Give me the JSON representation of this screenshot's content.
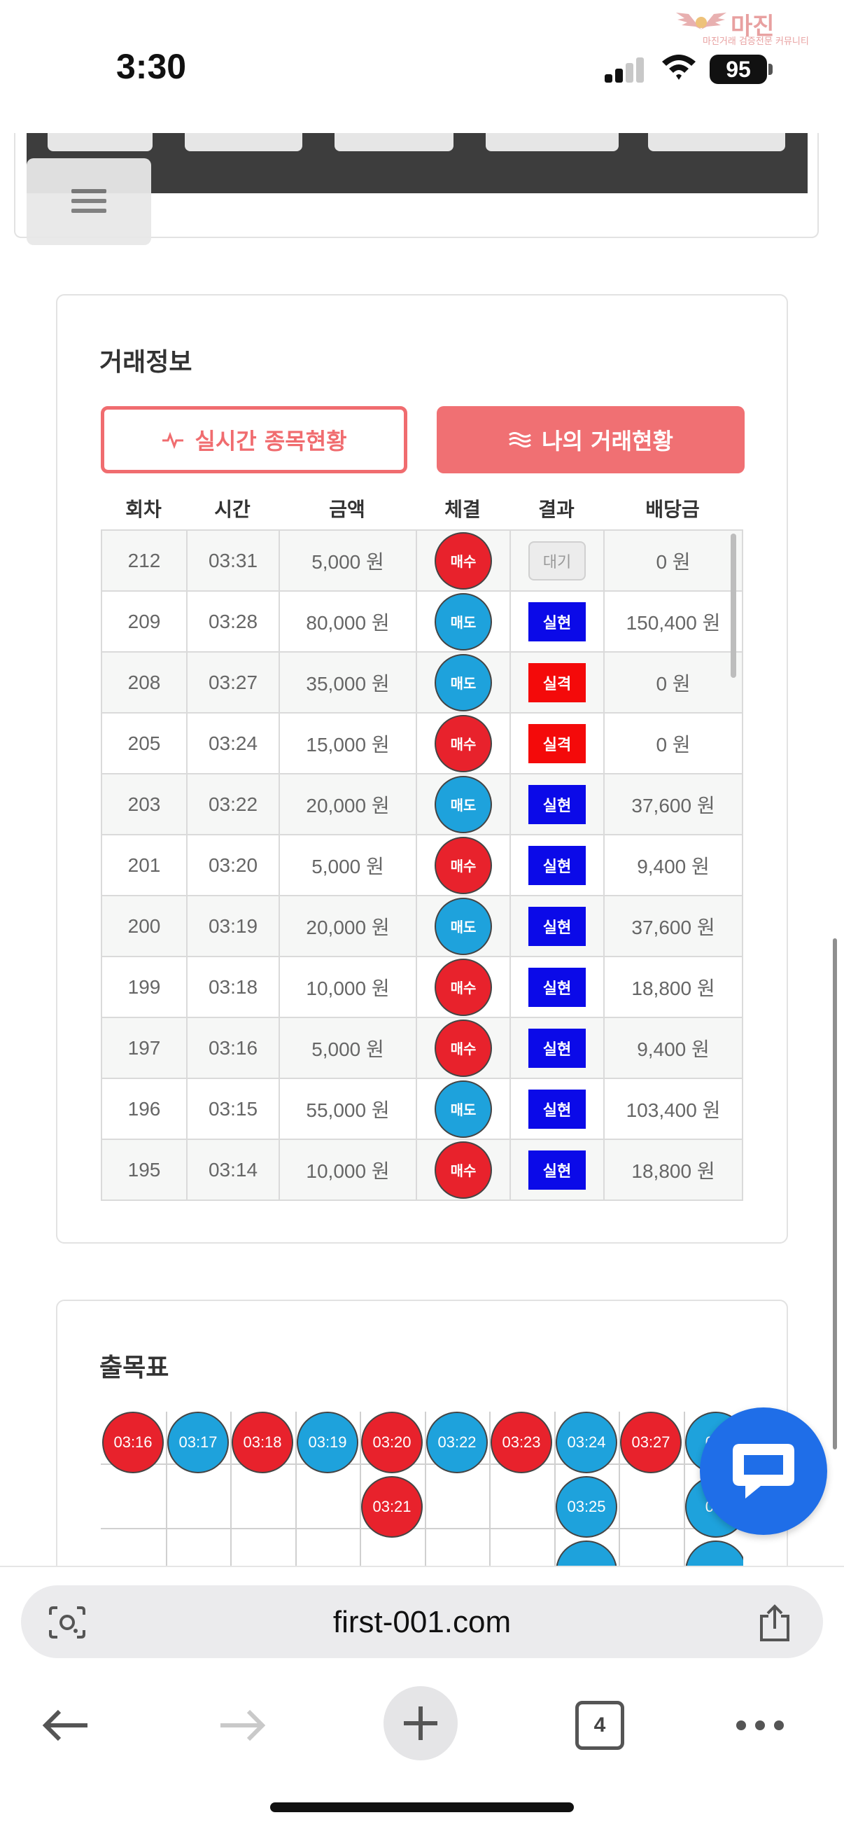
{
  "status_bar": {
    "time": "3:30",
    "battery": "95",
    "watermark_title": "마진",
    "watermark_sub": "마진거래 검증전문 커뮤니티"
  },
  "trade_info": {
    "title": "거래정보",
    "tab_realtime": "실시간 종목현황",
    "tab_my": "나의 거래현황",
    "columns": [
      "회차",
      "시간",
      "금액",
      "체결",
      "결과",
      "배당금"
    ],
    "rows": [
      {
        "round": "212",
        "time": "03:31",
        "amount": "5,000 원",
        "side": "매수",
        "result": "대기",
        "payout": "0 원"
      },
      {
        "round": "209",
        "time": "03:28",
        "amount": "80,000 원",
        "side": "매도",
        "result": "실현",
        "payout": "150,400 원"
      },
      {
        "round": "208",
        "time": "03:27",
        "amount": "35,000 원",
        "side": "매도",
        "result": "실격",
        "payout": "0 원"
      },
      {
        "round": "205",
        "time": "03:24",
        "amount": "15,000 원",
        "side": "매수",
        "result": "실격",
        "payout": "0 원"
      },
      {
        "round": "203",
        "time": "03:22",
        "amount": "20,000 원",
        "side": "매도",
        "result": "실현",
        "payout": "37,600 원"
      },
      {
        "round": "201",
        "time": "03:20",
        "amount": "5,000 원",
        "side": "매수",
        "result": "실현",
        "payout": "9,400 원"
      },
      {
        "round": "200",
        "time": "03:19",
        "amount": "20,000 원",
        "side": "매도",
        "result": "실현",
        "payout": "37,600 원"
      },
      {
        "round": "199",
        "time": "03:18",
        "amount": "10,000 원",
        "side": "매수",
        "result": "실현",
        "payout": "18,800 원"
      },
      {
        "round": "197",
        "time": "03:16",
        "amount": "5,000 원",
        "side": "매수",
        "result": "실현",
        "payout": "9,400 원"
      },
      {
        "round": "196",
        "time": "03:15",
        "amount": "55,000 원",
        "side": "매도",
        "result": "실현",
        "payout": "103,400 원"
      },
      {
        "round": "195",
        "time": "03:14",
        "amount": "10,000 원",
        "side": "매수",
        "result": "실현",
        "payout": "18,800 원"
      }
    ]
  },
  "result_table": {
    "title": "출목표",
    "balls": [
      {
        "col": 0,
        "row": 0,
        "label": "03:16",
        "color": "red"
      },
      {
        "col": 1,
        "row": 0,
        "label": "03:17",
        "color": "blue"
      },
      {
        "col": 2,
        "row": 0,
        "label": "03:18",
        "color": "red"
      },
      {
        "col": 3,
        "row": 0,
        "label": "03:19",
        "color": "blue"
      },
      {
        "col": 4,
        "row": 0,
        "label": "03:20",
        "color": "red"
      },
      {
        "col": 4,
        "row": 1,
        "label": "03:21",
        "color": "red"
      },
      {
        "col": 5,
        "row": 0,
        "label": "03:22",
        "color": "blue"
      },
      {
        "col": 6,
        "row": 0,
        "label": "03:23",
        "color": "red"
      },
      {
        "col": 7,
        "row": 0,
        "label": "03:24",
        "color": "blue"
      },
      {
        "col": 7,
        "row": 1,
        "label": "03:25",
        "color": "blue"
      },
      {
        "col": 7,
        "row": 2,
        "label": "",
        "color": "blue"
      },
      {
        "col": 8,
        "row": 0,
        "label": "03:27",
        "color": "red"
      },
      {
        "col": 9,
        "row": 0,
        "label": "03:",
        "color": "blue"
      },
      {
        "col": 9,
        "row": 1,
        "label": "03:",
        "color": "blue"
      },
      {
        "col": 9,
        "row": 2,
        "label": "",
        "color": "blue"
      }
    ]
  },
  "browser": {
    "url": "first-001.com",
    "tab_count": "4"
  },
  "colors": {
    "buy": "#e8222c",
    "sell": "#1ea2dc",
    "hit": "#0b0ae8",
    "miss": "#f40a0a",
    "accent": "#f07073",
    "chat": "#1f6ee8"
  }
}
